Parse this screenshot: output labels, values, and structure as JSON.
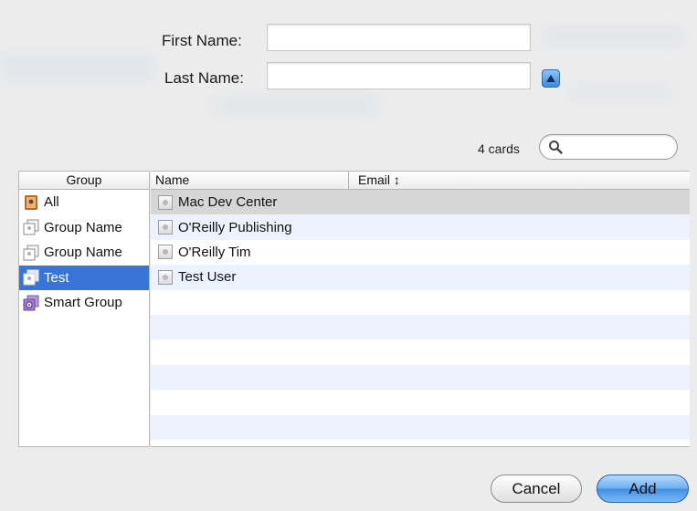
{
  "form": {
    "first_name_label": "First Name:",
    "first_name_value": "",
    "last_name_label": "Last Name:",
    "last_name_value": ""
  },
  "card_count": "4 cards",
  "search": {
    "placeholder": "",
    "value": ""
  },
  "groups": {
    "header": "Group",
    "items": [
      {
        "label": "All",
        "icon": "address-book-icon"
      },
      {
        "label": "Group Name",
        "icon": "group-icon"
      },
      {
        "label": "Group Name",
        "icon": "group-icon"
      },
      {
        "label": "Test",
        "icon": "group-icon",
        "selected": true
      },
      {
        "label": "Smart Group",
        "icon": "smart-group-icon"
      }
    ]
  },
  "records": {
    "name_header": "Name",
    "email_header": "Email ↕",
    "rows": [
      {
        "name": "Mac Dev Center",
        "email": ""
      },
      {
        "name": "O'Reilly Publishing",
        "email": ""
      },
      {
        "name": "O'Reilly Tim",
        "email": ""
      },
      {
        "name": "Test User",
        "email": ""
      }
    ]
  },
  "buttons": {
    "cancel": "Cancel",
    "add": "Add"
  },
  "colors": {
    "selection": "#3875d7",
    "default_button": "#3f8ee6",
    "alt_row": "#edf3fe"
  }
}
